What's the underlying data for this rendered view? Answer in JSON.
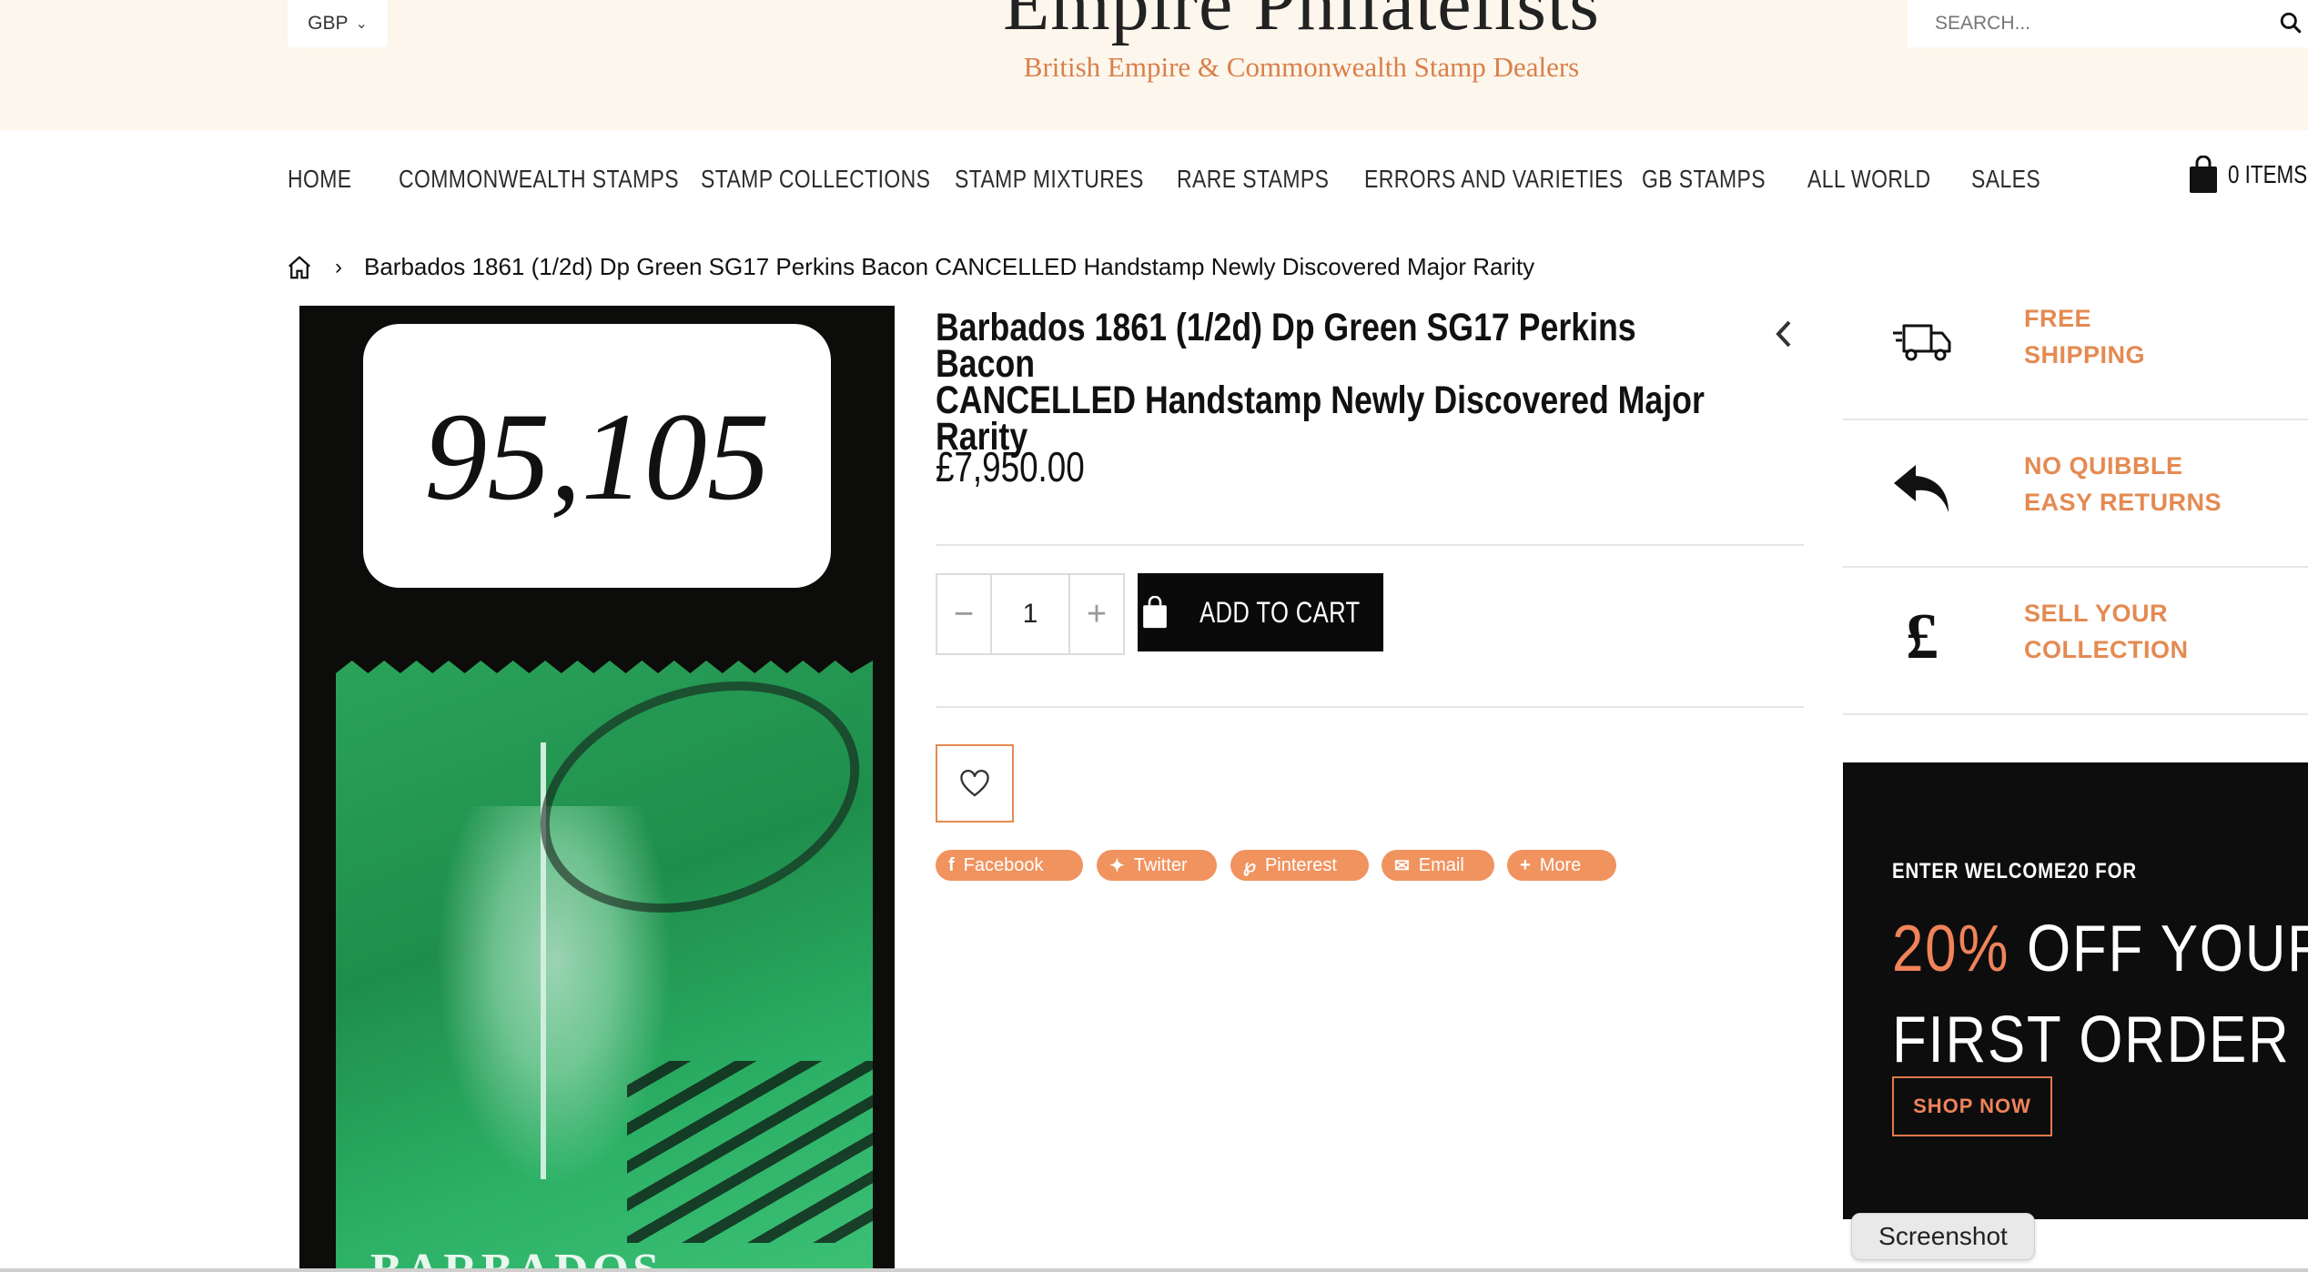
{
  "header": {
    "currency": "GBP",
    "logo_title": "Empire Philatelists",
    "logo_subtitle": "British Empire & Commonwealth Stamp Dealers",
    "search_placeholder": "SEARCH..."
  },
  "nav": {
    "items": [
      "HOME",
      "COMMONWEALTH STAMPS",
      "STAMP COLLECTIONS",
      "STAMP MIXTURES",
      "RARE STAMPS",
      "ERRORS AND VARIETIES",
      "GB STAMPS",
      "ALL WORLD",
      "SALES"
    ],
    "cart_label": "0 ITEMS"
  },
  "breadcrumb": {
    "current": "Barbados 1861 (1/2d) Dp Green SG17 Perkins Bacon CANCELLED Handstamp Newly Discovered Major Rarity"
  },
  "product": {
    "title_lines": [
      "Barbados 1861 (1/2d) Dp Green SG17 Perkins Bacon",
      "CANCELLED Handstamp Newly Discovered Major",
      "Rarity"
    ],
    "price": "£7,950.00",
    "quantity": "1",
    "add_to_cart": "ADD TO CART",
    "image_tag": "95,105",
    "stamp_name": "BARBADOS"
  },
  "share": [
    "Facebook",
    "Twitter",
    "Pinterest",
    "Email",
    "More"
  ],
  "features": [
    {
      "line1": "FREE",
      "line2": "SHIPPING",
      "icon": "delivery-truck-icon"
    },
    {
      "line1": "NO QUIBBLE",
      "line2": "EASY RETURNS",
      "icon": "return-arrow-icon"
    },
    {
      "line1": "SELL YOUR",
      "line2": "COLLECTION",
      "icon": "pound-sign-icon"
    }
  ],
  "promo": {
    "pre": "ENTER WELCOME20 FOR",
    "accent": "20%",
    "line1_rest": " OFF YOUR",
    "line2": "FIRST ORDER",
    "button": "SHOP NOW"
  },
  "tooltip": "Screenshot",
  "colors": {
    "accent": "#e48a52",
    "header_bg": "#fdf6ec",
    "promo_bg": "#0d0d0d"
  }
}
